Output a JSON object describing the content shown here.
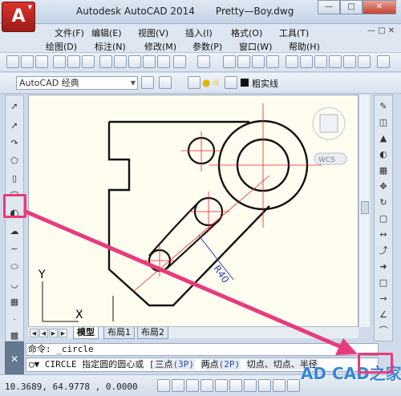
{
  "app": {
    "title": "Autodesk AutoCAD 2014",
    "filename": "Pretty—Boy.dwg",
    "logo_letter": "A"
  },
  "menubar": {
    "row1": [
      "文件(F)",
      "编辑(E)",
      "视图(V)",
      "插入(I)",
      "格式(O)",
      "工具(T)"
    ],
    "row2": [
      "绘图(D)",
      "标注(N)",
      "修改(M)",
      "参数(P)",
      "窗口(W)",
      "帮助(H)"
    ]
  },
  "workspace": {
    "value": "AutoCAD 经典"
  },
  "layer": {
    "linetype_label": "粗实线"
  },
  "viewcube": {
    "label": "WCS"
  },
  "drawing": {
    "dimension_text": "R40"
  },
  "axes": {
    "y_label": "Y",
    "x_label": "X"
  },
  "layout_tabs": [
    "模型",
    "布局1",
    "布局2"
  ],
  "command": {
    "history": "命令: _circle",
    "prompt_prefix": "CIRCLE 指定圆的圆心或",
    "opt1": "三点",
    "opt1_key": "(3P)",
    "opt2": "两点",
    "opt2_key": "(2P)",
    "opt3": "切点、切点、半径"
  },
  "status": {
    "coords": "10.3689,  64.9778 , 0.0000"
  },
  "watermark": "AD CAD之家",
  "colors": {
    "highlight": "#e83a7c",
    "drawing_line": "#111111",
    "center_line": "#e8242a",
    "dimension": "#2d3fb0"
  }
}
